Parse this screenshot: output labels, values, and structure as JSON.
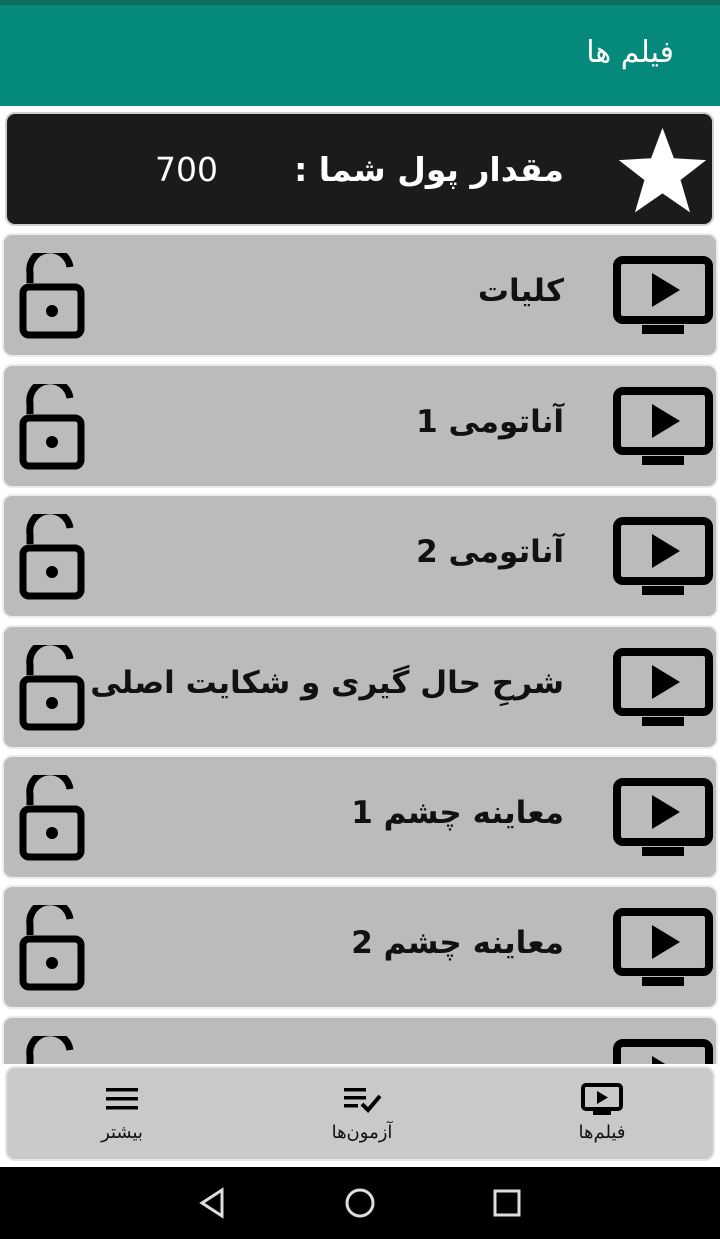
{
  "app_bar": {
    "title": "فیلم ها"
  },
  "balance": {
    "label": "مقدار پول شما :",
    "amount": "700",
    "icon": "star-icon"
  },
  "videos": [
    {
      "title": "کلیات",
      "icon": "tv-play-icon",
      "status_icon": "lock-open-icon"
    },
    {
      "title": "آناتومی 1",
      "icon": "tv-play-icon",
      "status_icon": "lock-open-icon"
    },
    {
      "title": "آناتومی 2",
      "icon": "tv-play-icon",
      "status_icon": "lock-open-icon"
    },
    {
      "title": "شرحِ حال گیری و شکایت اصلی",
      "icon": "tv-play-icon",
      "status_icon": "lock-open-icon"
    },
    {
      "title": "معاینه چشم 1",
      "icon": "tv-play-icon",
      "status_icon": "lock-open-icon"
    },
    {
      "title": "معاینه چشم 2",
      "icon": "tv-play-icon",
      "status_icon": "lock-open-icon"
    },
    {
      "title": "",
      "icon": "tv-play-icon",
      "status_icon": "lock-open-icon"
    }
  ],
  "bottom_nav": {
    "films": {
      "label": "فیلم‌ها",
      "icon": "tv-play-icon"
    },
    "exams": {
      "label": "آزمون‌ها",
      "icon": "checklist-icon"
    },
    "more": {
      "label": "بیشتر",
      "icon": "menu-icon"
    }
  },
  "system_nav": [
    "back-icon",
    "home-icon",
    "recents-icon"
  ],
  "colors": {
    "app_bar": "#04897a",
    "balance_bg": "#1b1b1b",
    "item_bg": "#bbbbbb",
    "nav_bg": "#c9c9c9"
  }
}
